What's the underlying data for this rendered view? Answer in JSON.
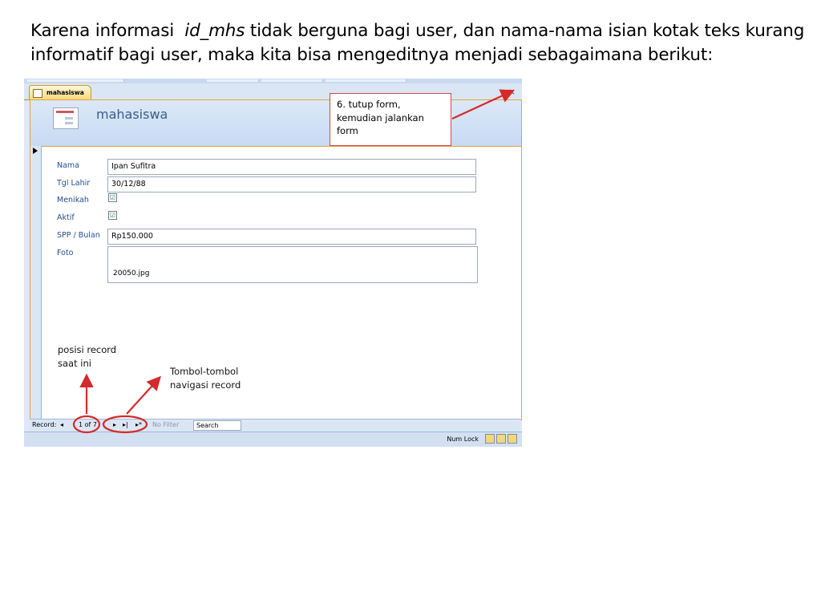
{
  "caption": {
    "line1_before": "Karena informasi",
    "line1_italic": "id_mhs",
    "line1_after": "tidak berguna bagi user, dan nama-nama isian kotak teks kurang",
    "line2": "informatif bagi user, maka kita bisa mengeditnya menjadi sebagaimana berikut:"
  },
  "window": {
    "tab_label": "mahasiswa",
    "close_glyph": "×",
    "form_title": "mahasiswa"
  },
  "fields": [
    {
      "label": "Nama",
      "value": "Ipan Sufitra",
      "type": "text"
    },
    {
      "label": "Tgl Lahir",
      "value": "30/12/88",
      "type": "text"
    },
    {
      "label": "Menikah",
      "checked": true,
      "type": "checkbox"
    },
    {
      "label": "Aktif",
      "checked": true,
      "type": "checkbox"
    },
    {
      "label": "SPP / Bulan",
      "value": "Rp150.000",
      "type": "text"
    },
    {
      "label": "Foto",
      "value": "20050.jpg",
      "type": "attachment"
    }
  ],
  "check_glyph": "☑",
  "annotations": {
    "callout": [
      "6. tutup form,",
      "kemudian jalankan",
      "form"
    ],
    "record_position": [
      "posisi record",
      "saat ini"
    ],
    "nav_buttons": [
      "Tombol-tombol",
      "navigasi record"
    ]
  },
  "navbar": {
    "record_label": "Record:",
    "first_glyph": "◂",
    "position": "1 of 7",
    "next_glyph": "▸",
    "last_glyph": "▸|",
    "new_glyph": "▸*",
    "filter_label": "No Filter",
    "search_label": "Search"
  },
  "status": {
    "numlock": "Num Lock"
  },
  "colors": {
    "annotation_red": "#d42a2a",
    "accent_orange": "#e3a33c",
    "label_blue": "#1f4e8c"
  }
}
